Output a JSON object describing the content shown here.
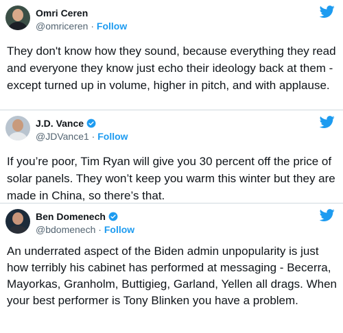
{
  "colors": {
    "accent": "#1d9bf0",
    "text": "#0f1419",
    "muted": "#536471",
    "divider": "#cfd9de"
  },
  "icons": {
    "twitter": "twitter-bird-icon",
    "verified": "verified-badge-icon"
  },
  "tweets": [
    {
      "name": "Omri Ceren",
      "handle": "@omriceren",
      "separator": " · ",
      "follow": "Follow",
      "verified": false,
      "text": "They don't know how they sound, because everything they read and everyone they know just echo their ideology back at them - except turned up in volume, higher in pitch, and with applause."
    },
    {
      "name": "J.D. Vance",
      "handle": "@JDVance1",
      "separator": " · ",
      "follow": "Follow",
      "verified": true,
      "text": "If you’re poor, Tim Ryan will give you 30 percent off the price of solar panels. They won’t keep you warm this winter but they are made in China, so there’s that."
    },
    {
      "name": "Ben Domenech",
      "handle": "@bdomenech",
      "separator": " · ",
      "follow": "Follow",
      "verified": true,
      "text": "An underrated aspect of the Biden admin unpopularity is just how terribly his cabinet has performed at messaging - Becerra, Mayorkas, Granholm, Buttigieg, Garland, Yellen all drags. When your best performer is Tony Blinken you have a problem."
    }
  ]
}
